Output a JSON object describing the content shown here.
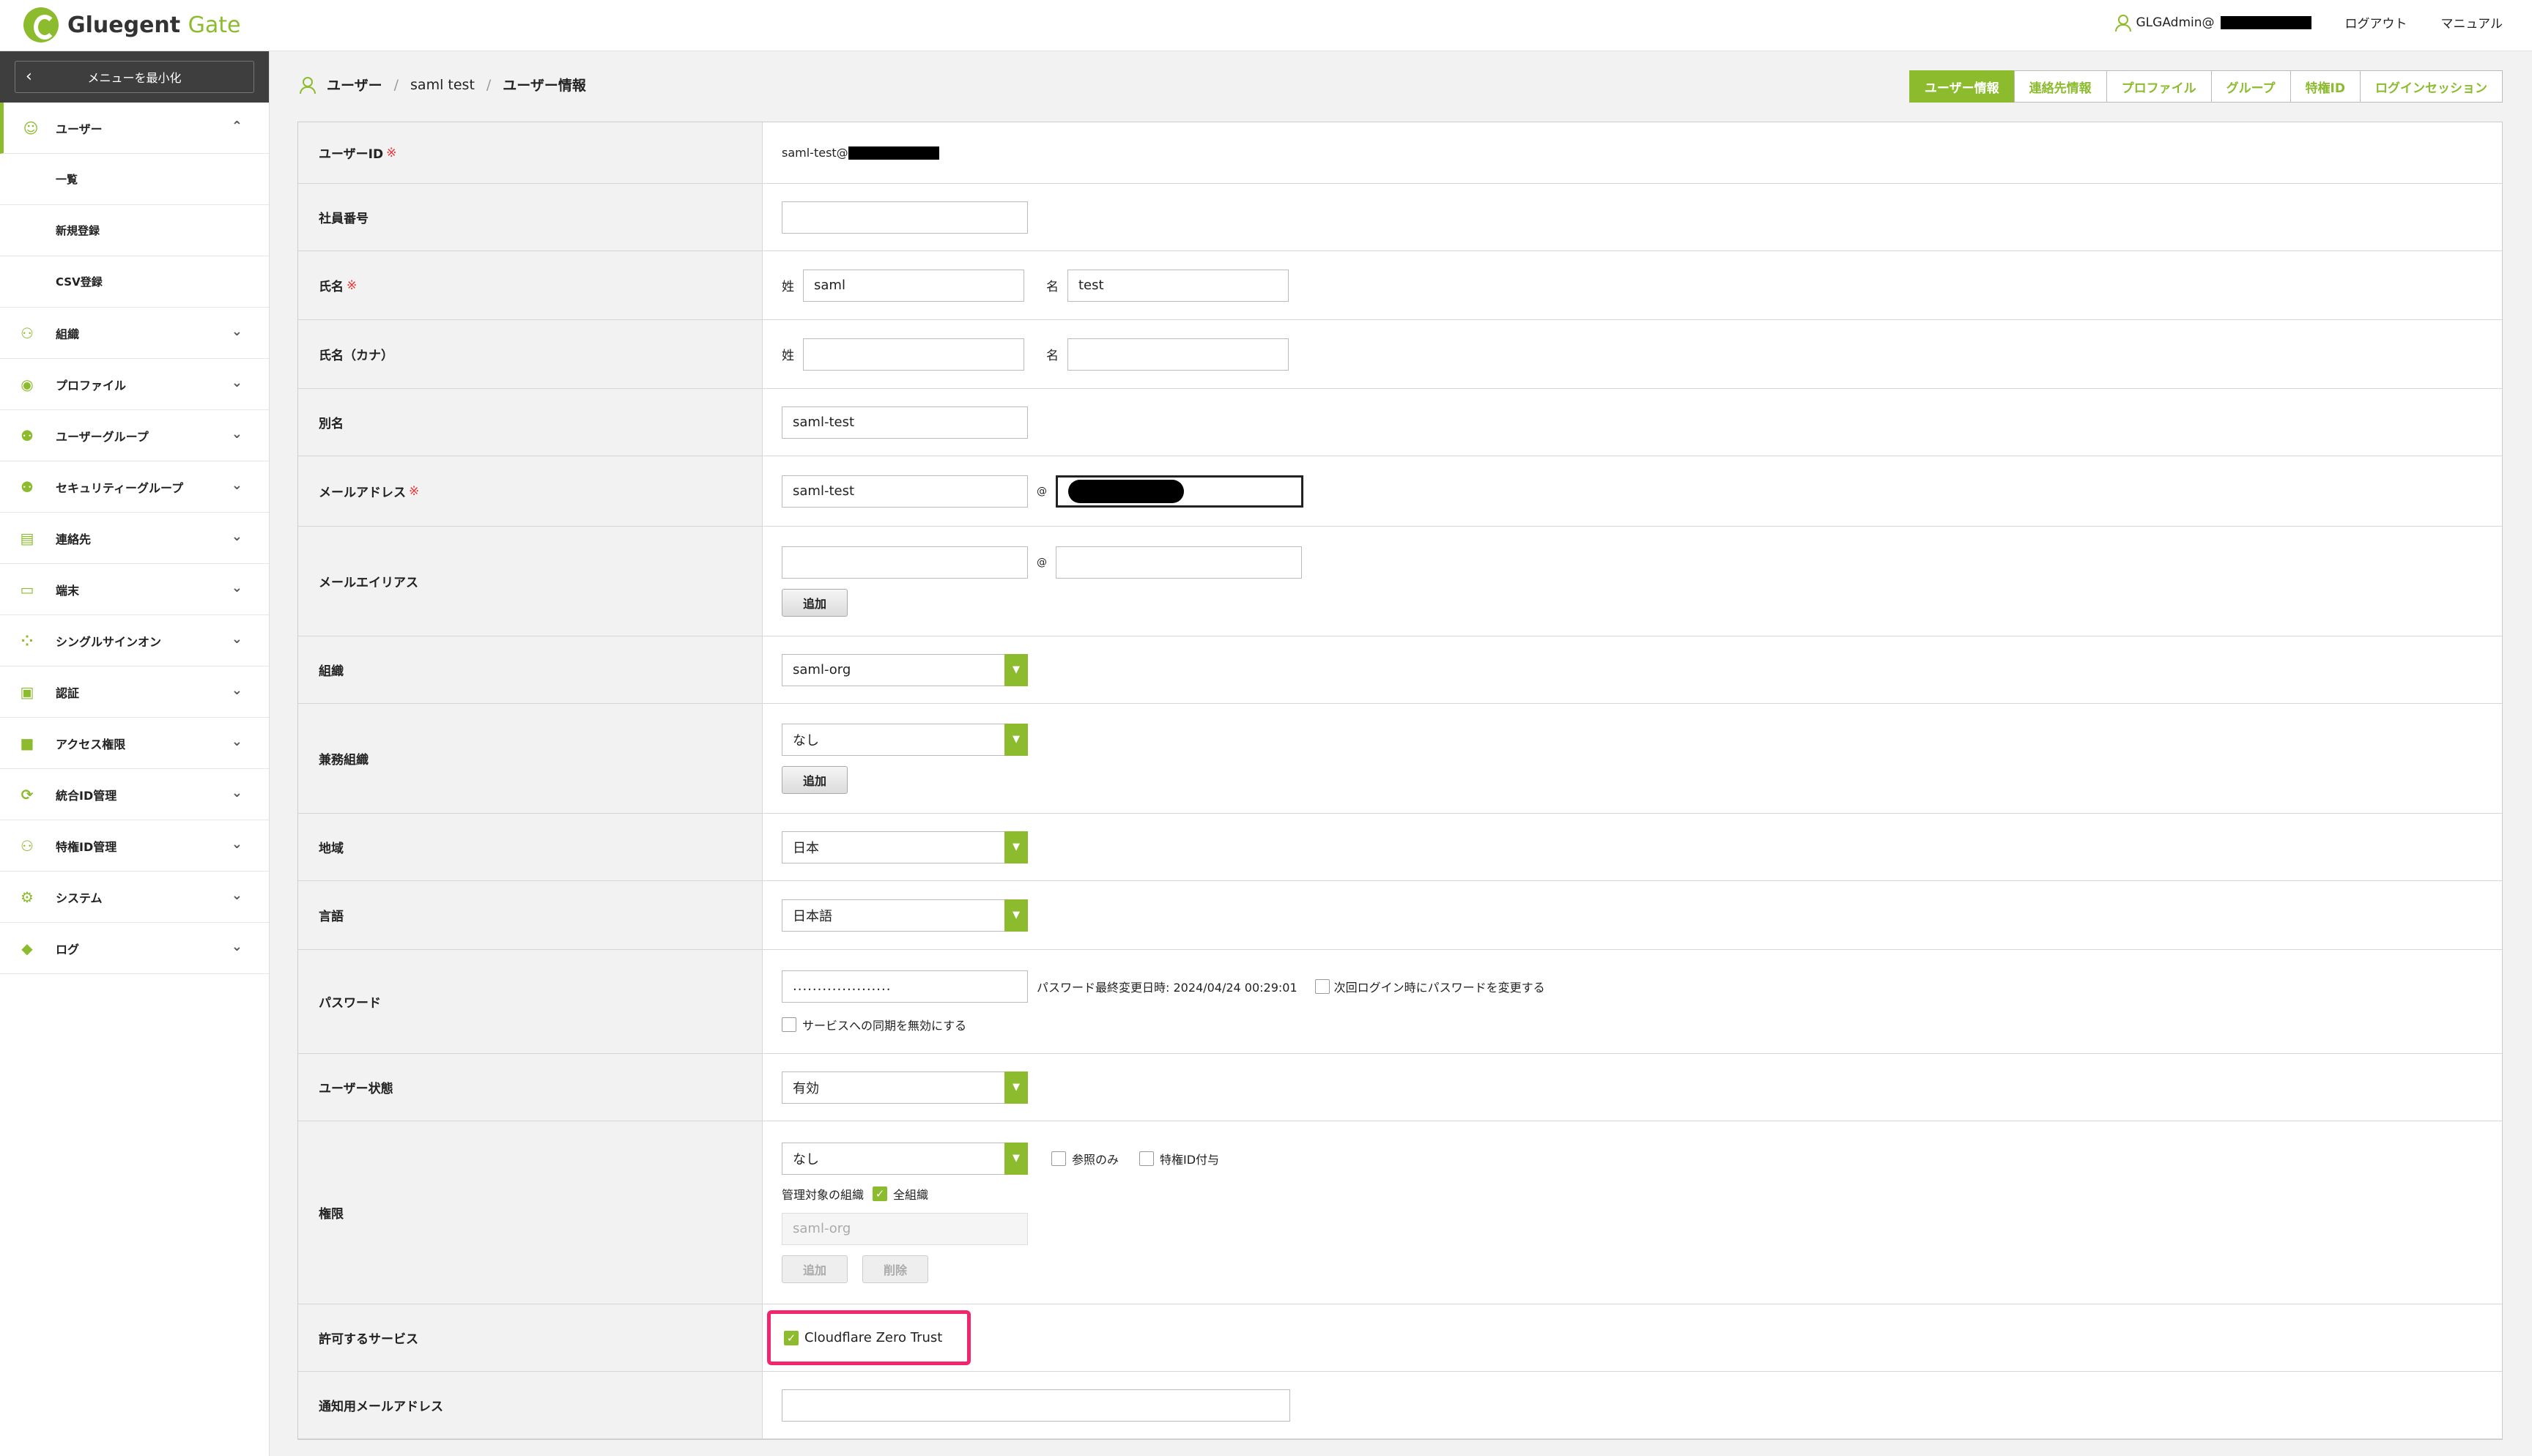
{
  "header": {
    "brand": "Gluegent",
    "brand_accent": "Gate",
    "user": "GLGAdmin@",
    "logout": "ログアウト",
    "manual": "マニュアル"
  },
  "sidebar": {
    "collapse_label": "メニューを最小化",
    "items": [
      {
        "label": "ユーザー",
        "icon": "person-icon",
        "expanded": true
      },
      {
        "label": "組織",
        "icon": "org-chart-icon"
      },
      {
        "label": "プロファイル",
        "icon": "profile-icon"
      },
      {
        "label": "ユーザーグループ",
        "icon": "user-group-icon"
      },
      {
        "label": "セキュリティーグループ",
        "icon": "security-group-icon"
      },
      {
        "label": "連絡先",
        "icon": "contact-icon"
      },
      {
        "label": "端末",
        "icon": "laptop-icon"
      },
      {
        "label": "シングルサインオン",
        "icon": "sso-icon"
      },
      {
        "label": "認証",
        "icon": "id-card-icon"
      },
      {
        "label": "アクセス権限",
        "icon": "lock-icon"
      },
      {
        "label": "統合ID管理",
        "icon": "sync-icon"
      },
      {
        "label": "特権ID管理",
        "icon": "privileged-user-icon"
      },
      {
        "label": "システム",
        "icon": "gear-icon"
      },
      {
        "label": "ログ",
        "icon": "tag-icon"
      }
    ],
    "subitems": [
      "一覧",
      "新規登録",
      "CSV登録"
    ]
  },
  "breadcrumb": [
    "ユーザー",
    "saml test",
    "ユーザー情報"
  ],
  "tabs": [
    "ユーザー情報",
    "連絡先情報",
    "プロファイル",
    "グループ",
    "特権ID",
    "ログインセッション"
  ],
  "form": {
    "required_mark": "※",
    "user_id": {
      "label": "ユーザーID",
      "value": "saml-test@"
    },
    "employee_no": {
      "label": "社員番号",
      "value": ""
    },
    "name": {
      "label": "氏名",
      "last_label": "姓",
      "last": "saml",
      "first_label": "名",
      "first": "test"
    },
    "name_kana": {
      "label": "氏名（カナ）",
      "last_label": "姓",
      "last": "",
      "first_label": "名",
      "first": ""
    },
    "alias": {
      "label": "別名",
      "value": "saml-test"
    },
    "email": {
      "label": "メールアドレス",
      "local": "saml-test",
      "at": "@"
    },
    "email_alias": {
      "label": "メールエイリアス",
      "local": "",
      "at": "@",
      "domain": "",
      "add": "追加"
    },
    "org": {
      "label": "組織",
      "value": "saml-org"
    },
    "concurrent_org": {
      "label": "兼務組織",
      "value": "なし",
      "add": "追加"
    },
    "region": {
      "label": "地域",
      "value": "日本"
    },
    "language": {
      "label": "言語",
      "value": "日本語"
    },
    "password": {
      "label": "パスワード",
      "masked": "....................",
      "last_changed": "パスワード最終変更日時: 2024/04/24 00:29:01",
      "change_next": "次回ログイン時にパスワードを変更する",
      "disable_sync": "サービスへの同期を無効にする"
    },
    "status": {
      "label": "ユーザー状態",
      "value": "有効"
    },
    "permission": {
      "label": "権限",
      "value": "なし",
      "read_only": "参照のみ",
      "grant_priv": "特権ID付与",
      "managed_org_label": "管理対象の組織",
      "all_orgs": "全組織",
      "org_placeholder": "saml-org",
      "add": "追加",
      "delete": "削除"
    },
    "services": {
      "label": "許可するサービス",
      "item": "Cloudflare Zero Trust"
    },
    "notify_email": {
      "label": "通知用メールアドレス",
      "value": ""
    }
  },
  "colors": {
    "accent": "#8cbb2e",
    "highlight": "#f2266f"
  }
}
